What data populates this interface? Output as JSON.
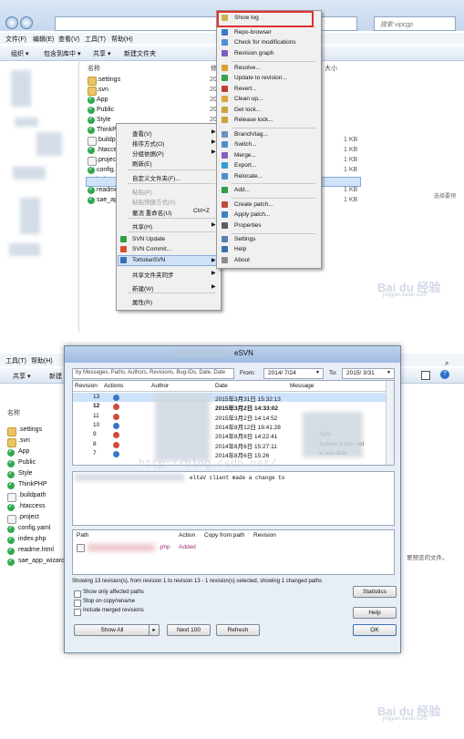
{
  "top": {
    "search_placeholder": "搜索 vipcgp",
    "menubar": [
      "文件(F)",
      "编辑(E)",
      "查看(V)",
      "工具(T)",
      "帮助(H)"
    ],
    "toolbar": [
      "组织 ▾",
      "包含到库中 ▾",
      "共享 ▾",
      "新建文件夹"
    ],
    "columns": {
      "name": "名称",
      "modified": "修",
      "size": "大小"
    },
    "date_prefix": "20",
    "files": [
      {
        "name": ".settings",
        "icon": "folder"
      },
      {
        "name": ".svn",
        "icon": "folder"
      },
      {
        "name": "App",
        "icon": "svn-ok"
      },
      {
        "name": "Public",
        "icon": "svn-ok"
      },
      {
        "name": "Style",
        "icon": "svn-ok"
      },
      {
        "name": "ThinkP",
        "icon": "svn-ok"
      },
      {
        "name": ".buildp",
        "icon": "plain"
      },
      {
        "name": ".htacce",
        "icon": "svn-ok"
      },
      {
        "name": ".projec",
        "icon": "plain"
      },
      {
        "name": "config.",
        "icon": "svn-ok"
      },
      {
        "name": "index.p",
        "icon": "svn-ok"
      },
      {
        "name": "readme",
        "icon": "svn-ok"
      },
      {
        "name": "sae_ap",
        "icon": "svn-ok"
      }
    ],
    "sizes": [
      "1 KB",
      "1 KB",
      "1 KB",
      "1 KB",
      "1 KB",
      "1 KB",
      "1 KB"
    ],
    "right_hint": "选择要预",
    "context_menu": [
      {
        "label": "查看(V)",
        "arrow": true
      },
      {
        "label": "排序方式(O)",
        "arrow": true
      },
      {
        "label": "分组依据(P)",
        "arrow": true
      },
      {
        "label": "刷新(E)",
        "arrow": false
      },
      {
        "label": "自定义文件夹(F)...",
        "arrow": false
      },
      {
        "label": "粘贴(P)",
        "arrow": false
      },
      {
        "label": "粘贴快捷方式(S)",
        "arrow": false
      },
      {
        "label": "撤消 重命名(U)",
        "shortcut": "Ctrl+Z"
      },
      {
        "label": "共享(H)",
        "arrow": true
      },
      {
        "label": "SVN Update",
        "icon": "svn-update-icon"
      },
      {
        "label": "SVN Commit...",
        "icon": "svn-commit-icon"
      },
      {
        "label": "TortoiseSVN",
        "arrow": true,
        "icon": "tortoisesvn-icon"
      },
      {
        "label": "共享文件夹同步",
        "arrow": true
      },
      {
        "label": "新建(W)",
        "arrow": true
      },
      {
        "label": "属性(R)",
        "arrow": false
      }
    ],
    "svn_menu": [
      {
        "label": "Show log",
        "highlight": true
      },
      {
        "label": "Repo-browser"
      },
      {
        "label": "Check for modifications"
      },
      {
        "label": "Revision graph"
      },
      {
        "label": "Resolve..."
      },
      {
        "label": "Update to revision..."
      },
      {
        "label": "Revert..."
      },
      {
        "label": "Clean up..."
      },
      {
        "label": "Get lock..."
      },
      {
        "label": "Release lock..."
      },
      {
        "label": "Branch/tag..."
      },
      {
        "label": "Switch..."
      },
      {
        "label": "Merge..."
      },
      {
        "label": "Export..."
      },
      {
        "label": "Relocate..."
      },
      {
        "label": "Add..."
      },
      {
        "label": "Create patch..."
      },
      {
        "label": "Apply patch..."
      },
      {
        "label": "Properties"
      },
      {
        "label": "Settings"
      },
      {
        "label": "Help"
      },
      {
        "label": "About"
      }
    ],
    "watermark": "Bai du 经验",
    "watermark_url": "jingyan.baidu.com"
  },
  "bottom": {
    "menubar": [
      "工具(T)",
      "帮助(H)"
    ],
    "toolbar": [
      "共享 ▾",
      "新建"
    ],
    "sidebar_header": "名称",
    "files": [
      {
        "name": ".settings",
        "icon": "folder"
      },
      {
        "name": ".svn",
        "icon": "folder"
      },
      {
        "name": "App",
        "icon": "svn-ok"
      },
      {
        "name": "Public",
        "icon": "svn-ok"
      },
      {
        "name": "Style",
        "icon": "svn-ok"
      },
      {
        "name": "ThinkPHP",
        "icon": "svn-ok"
      },
      {
        "name": ".buildpath",
        "icon": "plain"
      },
      {
        "name": ".htaccess",
        "icon": "svn-ok"
      },
      {
        "name": ".project",
        "icon": "plain"
      },
      {
        "name": "config.yaml",
        "icon": "svn-ok"
      },
      {
        "name": "index.php",
        "icon": "svn-ok"
      },
      {
        "name": "readme.html",
        "icon": "svn-ok"
      },
      {
        "name": "sae_app_wizard",
        "icon": "svn-ok"
      }
    ],
    "right_hint": "要预览的文件。",
    "dialog": {
      "title": "eSVN",
      "filter_placeholder": "by Messages, Paths, Authors, Revisions, Bug-IDs, Date, Date",
      "from_label": "From:",
      "from_value": "2014/ 7/24",
      "to_label": "To:",
      "to_value": "2015/ 3/31",
      "log_headers": [
        "Revision",
        "Actions",
        "Author",
        "Date",
        "Message"
      ],
      "log_rows": [
        {
          "rev": "13",
          "date": "2015年3月31日 15:32:13",
          "msg": "",
          "bold": false,
          "selected": true
        },
        {
          "rev": "12",
          "date": "2015年3月2日 14:33:02",
          "msg": "",
          "bold": true,
          "selected": false
        },
        {
          "rev": "11",
          "date": "2015年3月2日 14:14:52",
          "msg": "",
          "bold": false,
          "selected": false
        },
        {
          "rev": "10",
          "date": "2014年8月12日 19:41:28",
          "msg": "",
          "bold": false,
          "selected": false
        },
        {
          "rev": "9",
          "date": "2014年8月8日 14:22:41",
          "msg": "Auto",
          "bold": false,
          "selected": false
        },
        {
          "rev": "8",
          "date": "2014年8月6日 15:27:11",
          "msg": "Autove  a non-del",
          "bold": false,
          "selected": false
        },
        {
          "rev": "7",
          "date": "2014年8月6日 15:26",
          "msg": "a non-dele",
          "bold": false,
          "selected": false
        }
      ],
      "message_text": "eltaV client made a change to",
      "watermark": "http://blog.csdn.net/",
      "path_headers": [
        "Path",
        "Action",
        "Copy from path",
        "Revision"
      ],
      "path_rows": [
        {
          "path": ".php",
          "action": "Added"
        }
      ],
      "status_text": "Showing 13 revision(s), from revision 1 to revision 13 - 1 revision(s) selected, showing 1 changed paths",
      "checkboxes": [
        "Show only affected paths",
        "Stop on copy/rename",
        "Include merged revisions"
      ],
      "buttons": {
        "statistics": "Statistics",
        "help": "Help",
        "show_all": "Show All",
        "next100": "Next 100",
        "refresh": "Refresh",
        "ok": "OK"
      }
    },
    "watermark": "Bai du 经验",
    "watermark_url": "jingyan.baidu.com"
  }
}
